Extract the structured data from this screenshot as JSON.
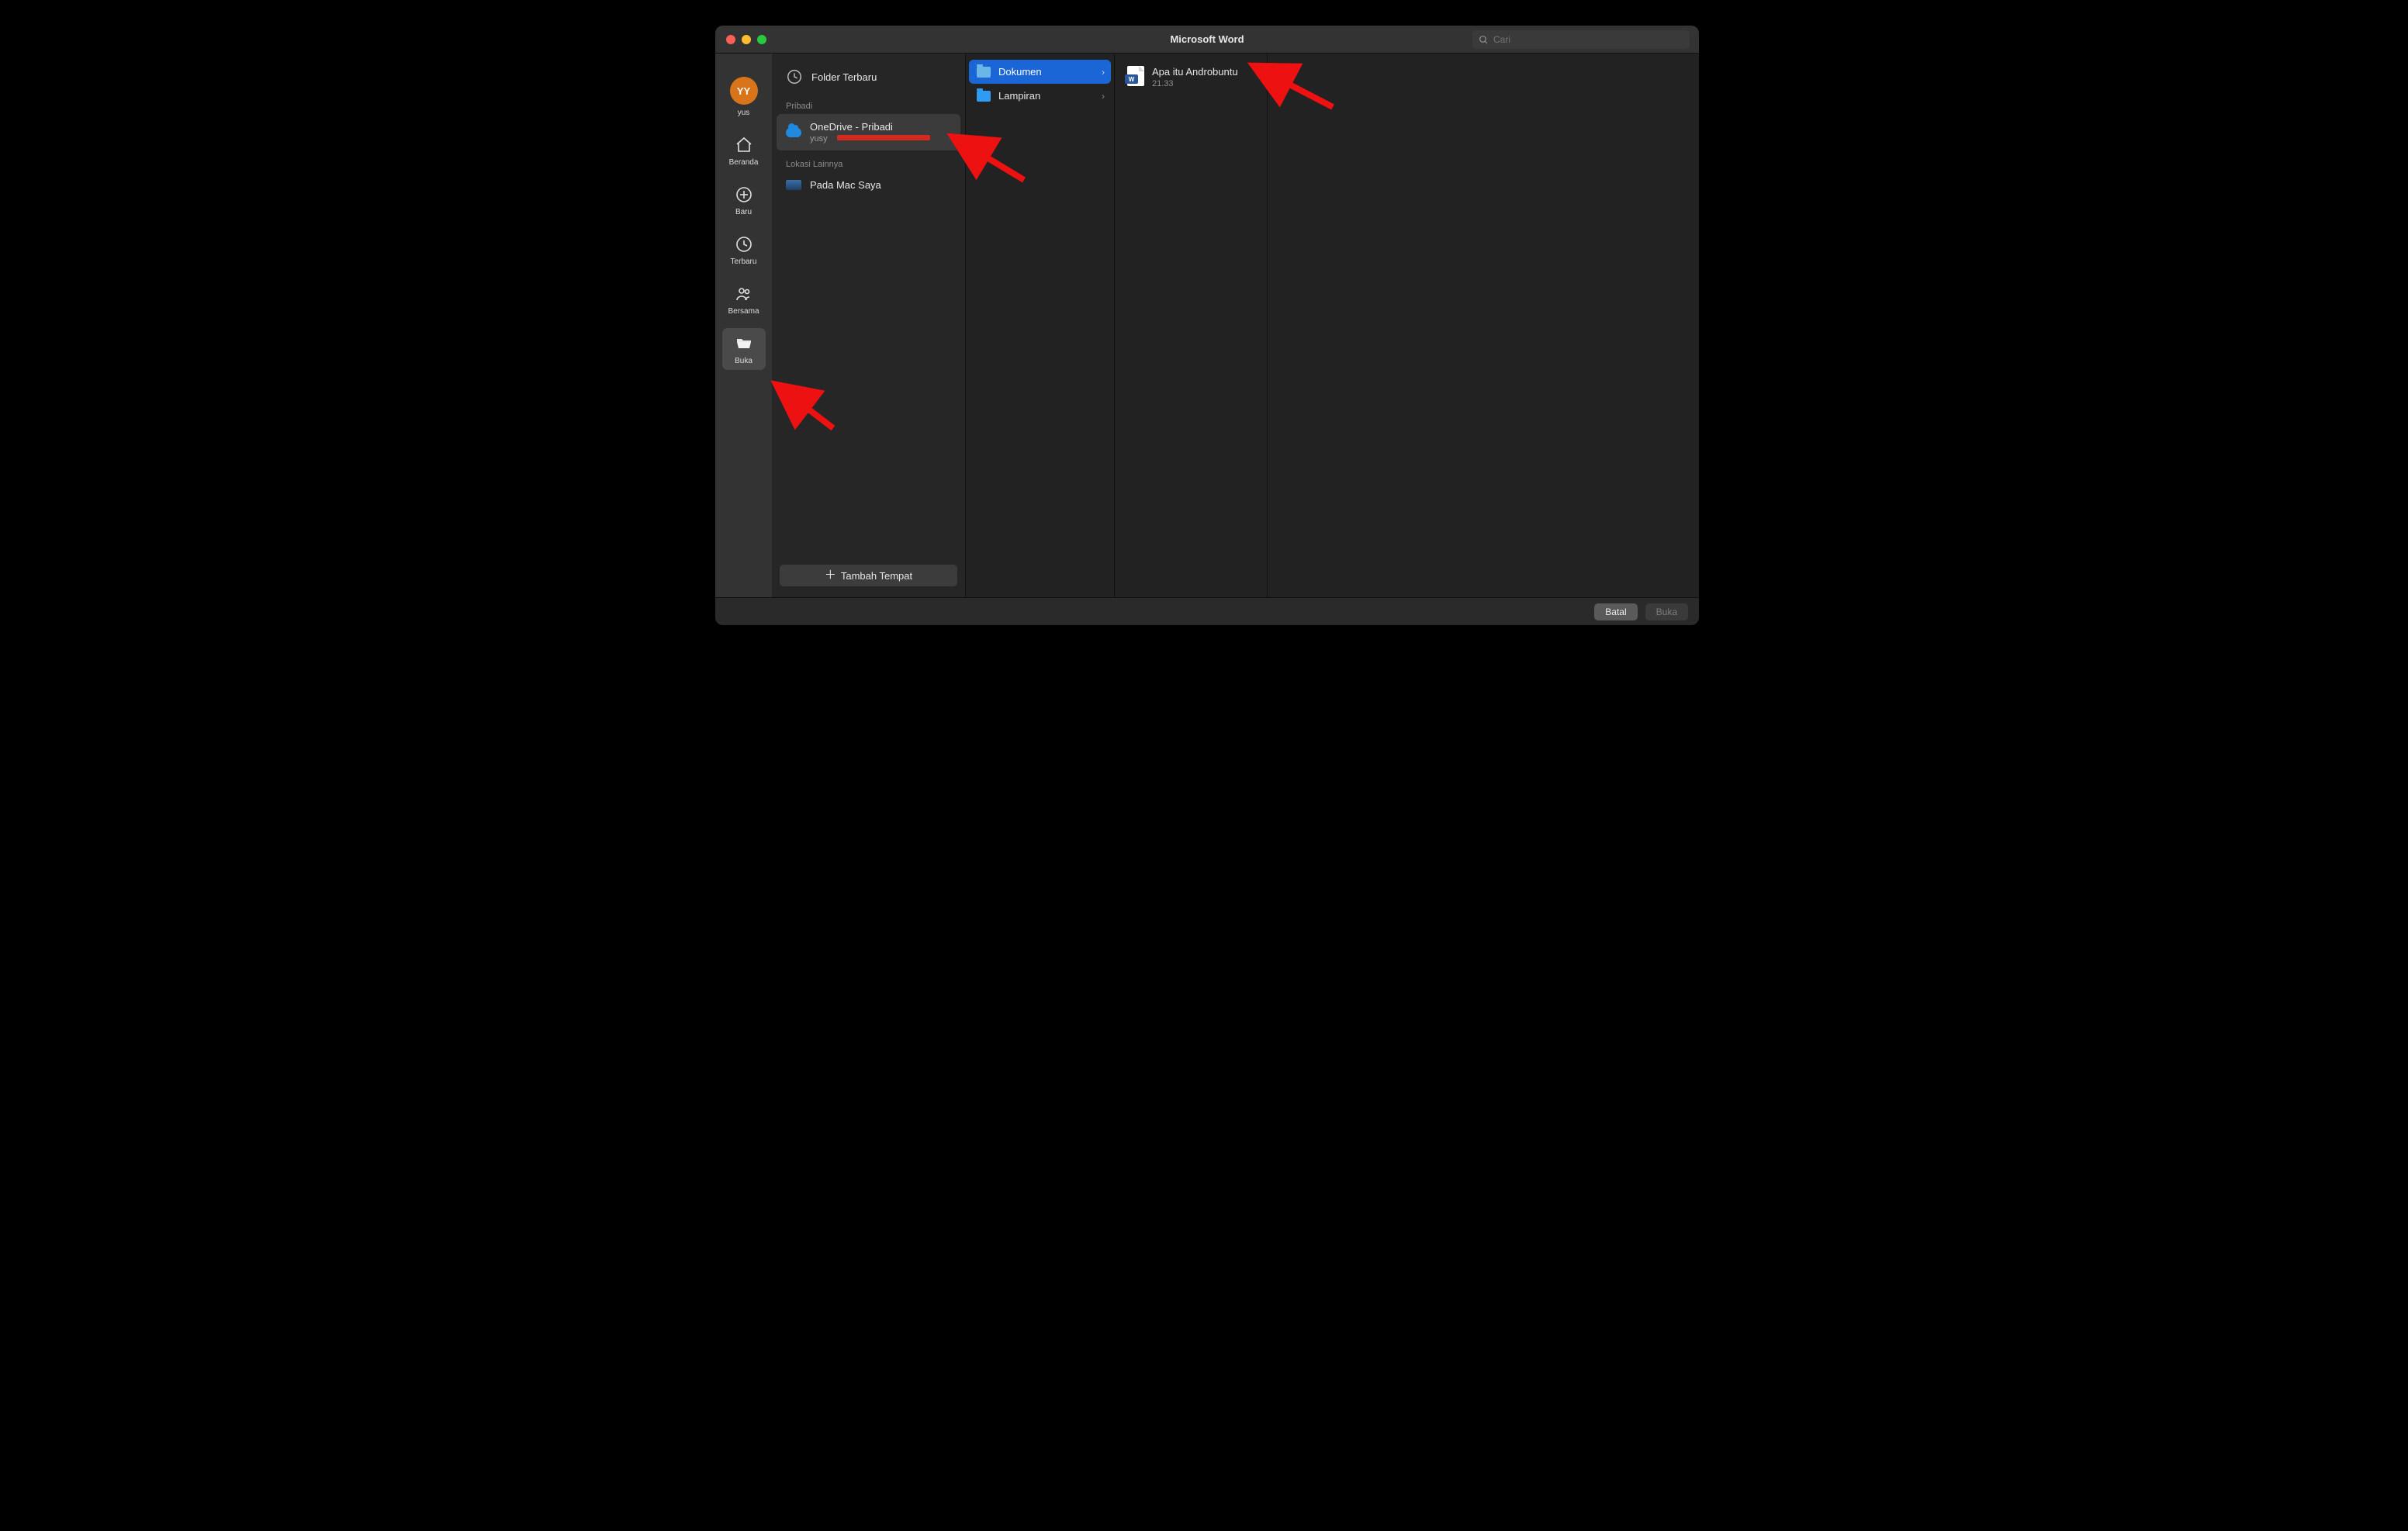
{
  "titlebar": {
    "title": "Microsoft Word"
  },
  "search": {
    "placeholder": "Cari"
  },
  "nav": {
    "avatar_initials": "YY",
    "items": [
      {
        "key": "user",
        "label": "yus"
      },
      {
        "key": "home",
        "label": "Beranda"
      },
      {
        "key": "new",
        "label": "Baru"
      },
      {
        "key": "recent",
        "label": "Terbaru"
      },
      {
        "key": "shared",
        "label": "Bersama"
      },
      {
        "key": "open",
        "label": "Buka"
      }
    ],
    "active": "open"
  },
  "locations": {
    "recent_label": "Folder Terbaru",
    "section_personal": "Pribadi",
    "section_other": "Lokasi Lainnya",
    "onedrive": {
      "title": "OneDrive - Pribadi",
      "subtitle": "yusy"
    },
    "mac": {
      "title": "Pada Mac Saya"
    },
    "add_place": "Tambah Tempat"
  },
  "folders": [
    {
      "name": "Dokumen",
      "selected": true
    },
    {
      "name": "Lampiran",
      "selected": false
    }
  ],
  "files": [
    {
      "name": "Apa itu Androbuntu",
      "time": "21.33",
      "badge": "W"
    }
  ],
  "footer": {
    "cancel": "Batal",
    "open": "Buka"
  }
}
